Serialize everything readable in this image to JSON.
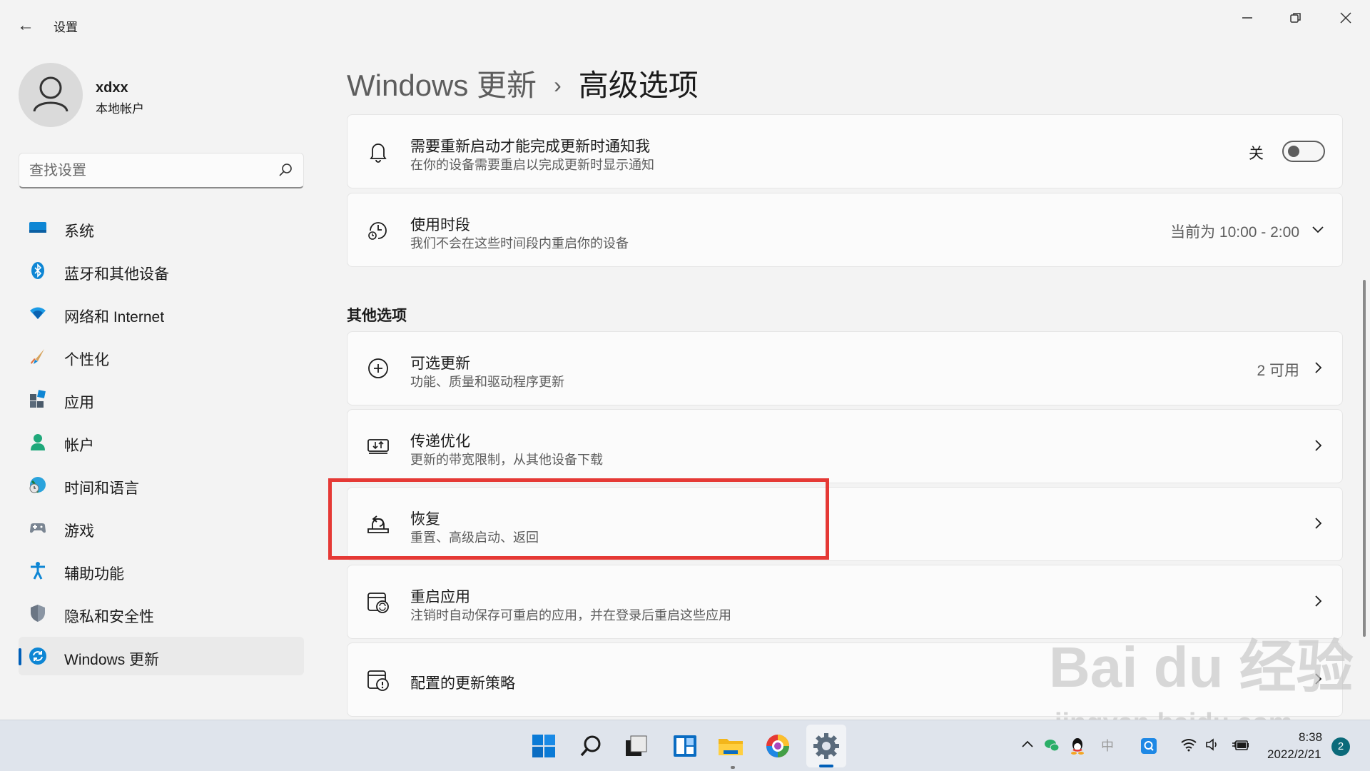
{
  "window": {
    "title": "设置",
    "back_icon": "back-arrow-icon",
    "minimize_icon": "minimize-icon",
    "maximize_icon": "restore-icon",
    "close_icon": "close-icon"
  },
  "user": {
    "name": "xdxx",
    "type": "本地帐户"
  },
  "search": {
    "placeholder": "查找设置"
  },
  "sidebar": {
    "items": [
      {
        "label": "系统",
        "icon": "system-icon",
        "active": false
      },
      {
        "label": "蓝牙和其他设备",
        "icon": "bluetooth-icon",
        "active": false
      },
      {
        "label": "网络和 Internet",
        "icon": "wifi-icon",
        "active": false
      },
      {
        "label": "个性化",
        "icon": "brush-icon",
        "active": false
      },
      {
        "label": "应用",
        "icon": "apps-icon",
        "active": false
      },
      {
        "label": "帐户",
        "icon": "account-icon",
        "active": false
      },
      {
        "label": "时间和语言",
        "icon": "globe-clock-icon",
        "active": false
      },
      {
        "label": "游戏",
        "icon": "gamepad-icon",
        "active": false
      },
      {
        "label": "辅助功能",
        "icon": "accessibility-icon",
        "active": false
      },
      {
        "label": "隐私和安全性",
        "icon": "shield-icon",
        "active": false
      },
      {
        "label": "Windows 更新",
        "icon": "windows-update-icon",
        "active": true
      }
    ]
  },
  "breadcrumb": {
    "parent": "Windows 更新",
    "separator": "›",
    "current": "高级选项"
  },
  "settings": {
    "notify_restart": {
      "title": "需要重新启动才能完成更新时通知我",
      "subtitle": "在你的设备需要重启以完成更新时显示通知",
      "toggle_label": "关",
      "toggle_on": false
    },
    "active_hours": {
      "title": "使用时段",
      "subtitle": "我们不会在这些时间段内重启你的设备",
      "value": "当前为 10:00 - 2:00"
    }
  },
  "other_options": {
    "section_title": "其他选项",
    "items": [
      {
        "title": "可选更新",
        "subtitle": "功能、质量和驱动程序更新",
        "right": "2 可用",
        "icon": "plus-circle-icon"
      },
      {
        "title": "传递优化",
        "subtitle": "更新的带宽限制，从其他设备下载",
        "right": "",
        "icon": "delivery-optimization-icon"
      },
      {
        "title": "恢复",
        "subtitle": "重置、高级启动、返回",
        "right": "",
        "icon": "recovery-icon"
      },
      {
        "title": "重启应用",
        "subtitle": "注销时自动保存可重启的应用，并在登录后重启这些应用",
        "right": "",
        "icon": "restart-apps-icon"
      },
      {
        "title": "配置的更新策略",
        "subtitle": "",
        "right": "",
        "icon": "policy-icon"
      }
    ]
  },
  "watermark": {
    "logo": "Bai du 经验",
    "url": "jingyan.baidu.com"
  },
  "taskbar": {
    "icons": [
      "windows-start-icon",
      "search-icon",
      "task-view-icon",
      "widgets-icon",
      "file-explorer-icon",
      "browser-icon",
      "settings-gear-icon"
    ],
    "tray": [
      "chevron-up-icon",
      "wechat-icon",
      "qq-icon",
      "ime-icon",
      "app-q-icon",
      "wifi-icon",
      "volume-icon",
      "battery-icon"
    ],
    "ime_label": "中",
    "time": "8:38",
    "date": "2022/2/21",
    "notification_count": "2"
  },
  "colors": {
    "accent": "#005fb8",
    "highlight": "#e53935"
  }
}
